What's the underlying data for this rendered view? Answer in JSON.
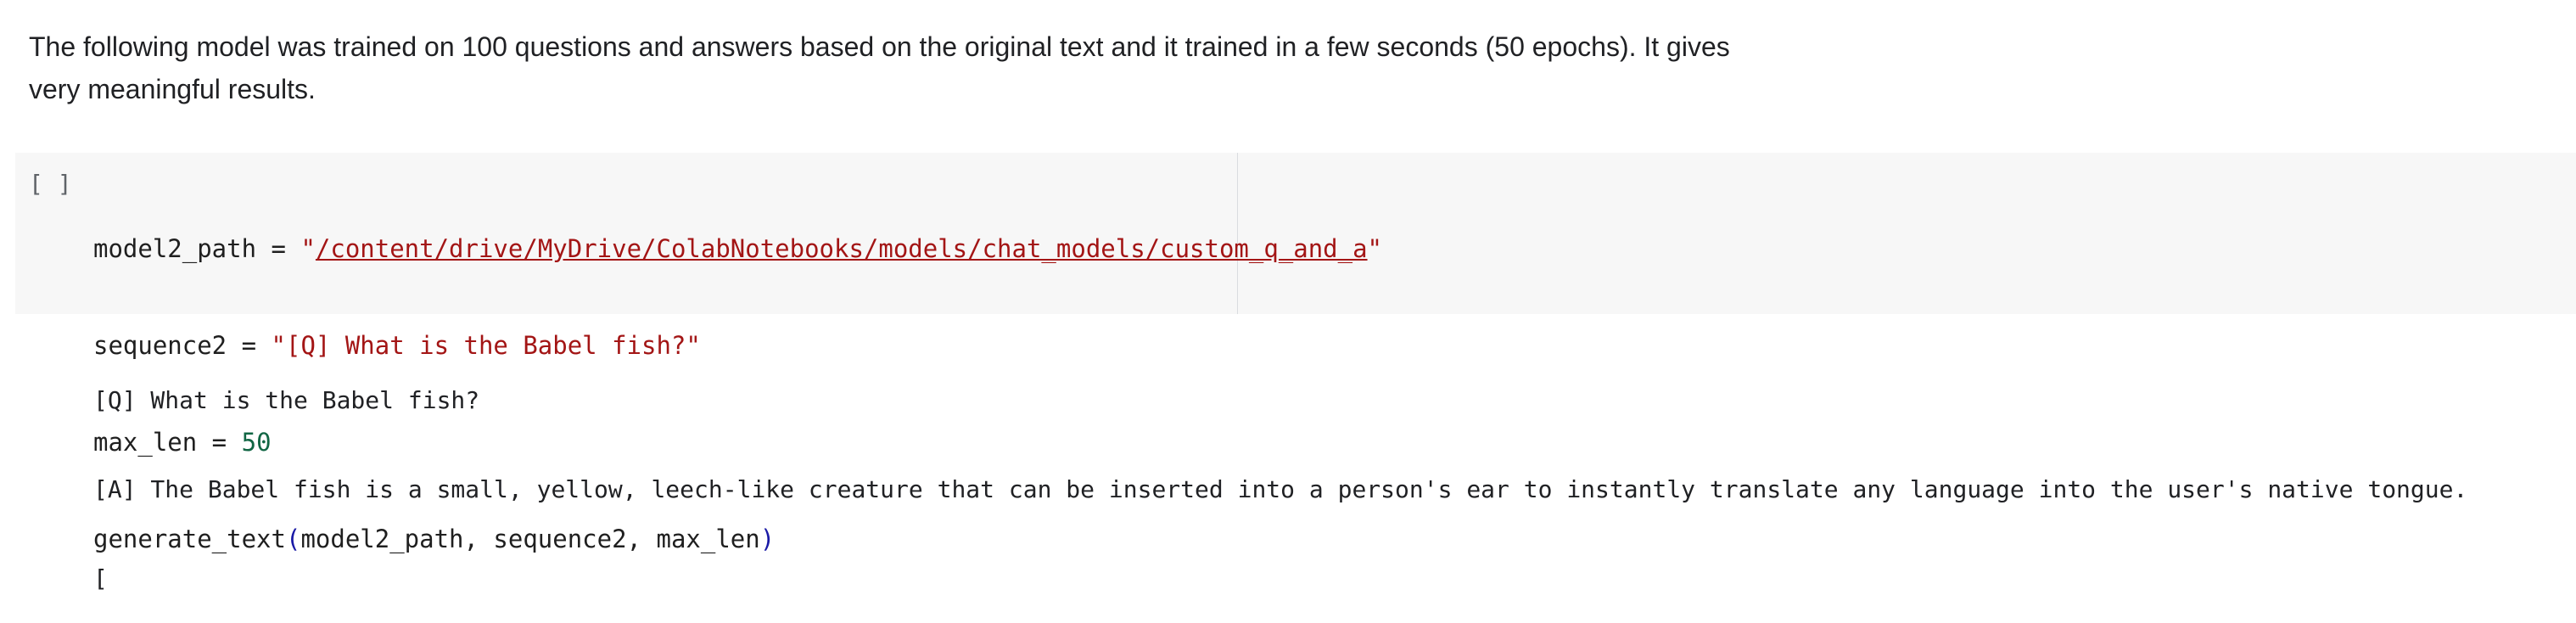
{
  "text_cell": {
    "line1": "The following model was trained on 100 questions and answers based on the original text and it trained in a few seconds (50 epochs). It gives",
    "line2": "very meaningful results."
  },
  "code_cell": {
    "run_indicator": "[ ]",
    "line1": {
      "var": "model2_path",
      "op": " = ",
      "q_open": "\"",
      "path": "/content/drive/MyDrive/ColabNotebooks/models/chat_models/custom_q_and_a",
      "q_close": "\""
    },
    "line2": {
      "var": "sequence2",
      "op": " = ",
      "string": "\"[Q] What is the Babel fish?\""
    },
    "line3": {
      "var": "max_len",
      "op": " = ",
      "number": "50"
    },
    "line4": {
      "func": "generate_text",
      "paren_open": "(",
      "args": "model2_path, sequence2, max_len",
      "paren_close": ")"
    }
  },
  "output": {
    "lines": [
      "[Q] What is the Babel fish?",
      "[A] The Babel fish is a small, yellow, leech-like creature that can be inserted into a person's ear to instantly translate any language into the user's native tongue.",
      "["
    ]
  },
  "colors": {
    "string": "#a31515",
    "number": "#116644",
    "paren": "#1a1aa6",
    "cell_bg": "#f7f7f7"
  }
}
